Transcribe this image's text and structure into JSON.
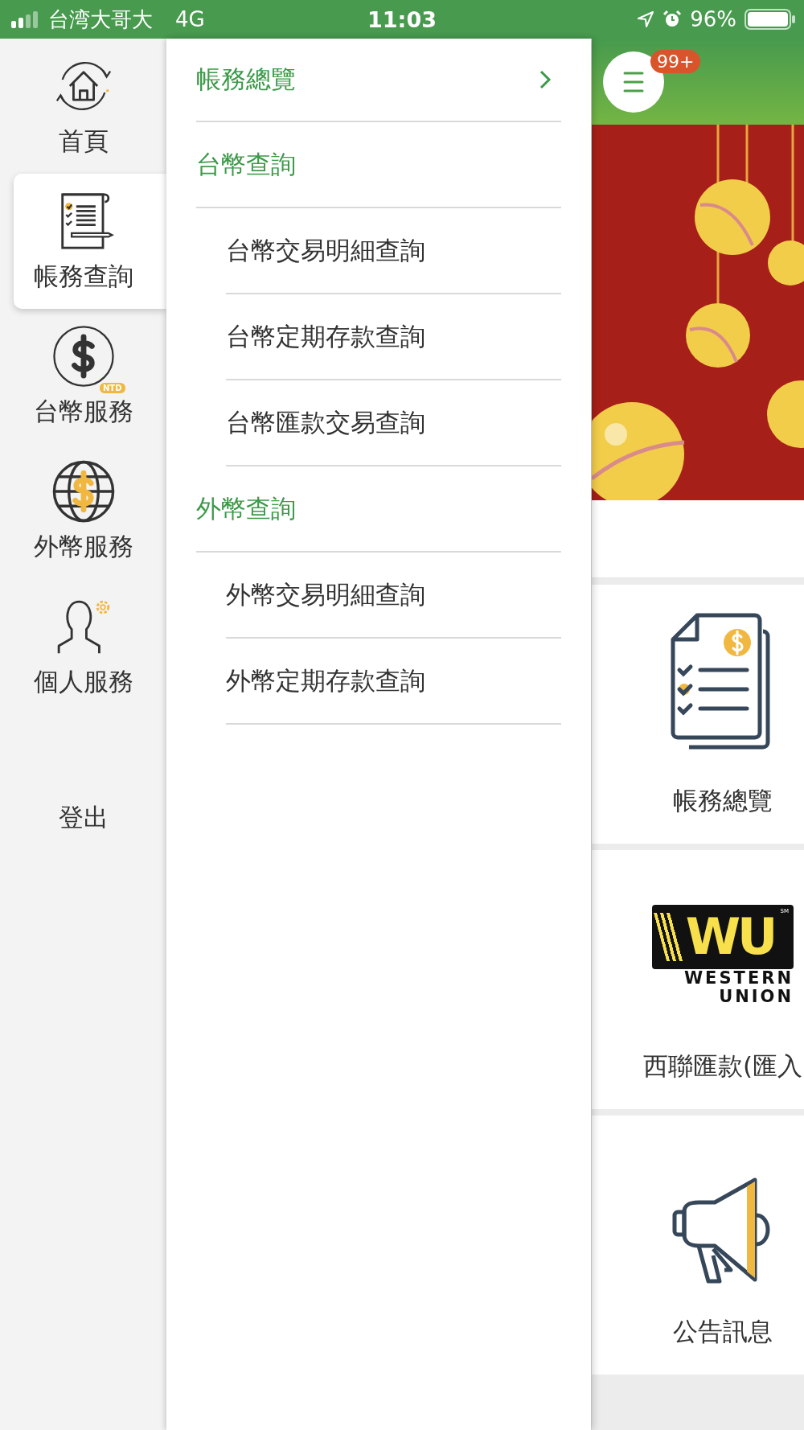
{
  "status_bar": {
    "carrier": "台湾大哥大",
    "network": "4G",
    "time": "11:03",
    "battery": "96%"
  },
  "sidebar": {
    "items": [
      {
        "label": "首頁",
        "kind": "home",
        "selected": false
      },
      {
        "label": "帳務查詢",
        "kind": "ledger",
        "selected": true
      },
      {
        "label": "台幣服務",
        "kind": "ntd",
        "selected": false,
        "tag": "NTD"
      },
      {
        "label": "外幣服務",
        "kind": "globe",
        "selected": false
      },
      {
        "label": "個人服務",
        "kind": "person",
        "selected": false
      }
    ],
    "logout": "登出"
  },
  "menu": [
    {
      "label": "帳務總覽",
      "kind": "link"
    },
    {
      "label": "台幣查詢",
      "kind": "section",
      "children": [
        {
          "label": "台幣交易明細查詢"
        },
        {
          "label": "台幣定期存款查詢"
        },
        {
          "label": "台幣匯款交易查詢"
        }
      ]
    },
    {
      "label": "外幣查詢",
      "kind": "section",
      "children": [
        {
          "label": "外幣交易明細查詢"
        },
        {
          "label": "外幣定期存款查詢"
        }
      ]
    }
  ],
  "home": {
    "badge": "99+",
    "tiles": [
      {
        "label": "帳務總覽",
        "kind": "statement"
      },
      {
        "label": "西聯匯款(匯入",
        "kind": "western-union",
        "logo": {
          "mark": "WU",
          "service_mark": "SM",
          "lines": [
            "WESTERN",
            "UNION"
          ]
        }
      },
      {
        "label": "公告訊息",
        "kind": "megaphone"
      }
    ]
  }
}
